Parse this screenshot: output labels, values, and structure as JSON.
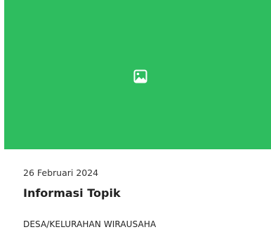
{
  "card": {
    "thumbnail": {
      "icon": "image-icon",
      "bg_color": "#2ebd5f"
    },
    "date": "26 Februari 2024",
    "title": "Informasi Topik",
    "category": "DESA/KELURAHAN WIRAUSAHA"
  }
}
